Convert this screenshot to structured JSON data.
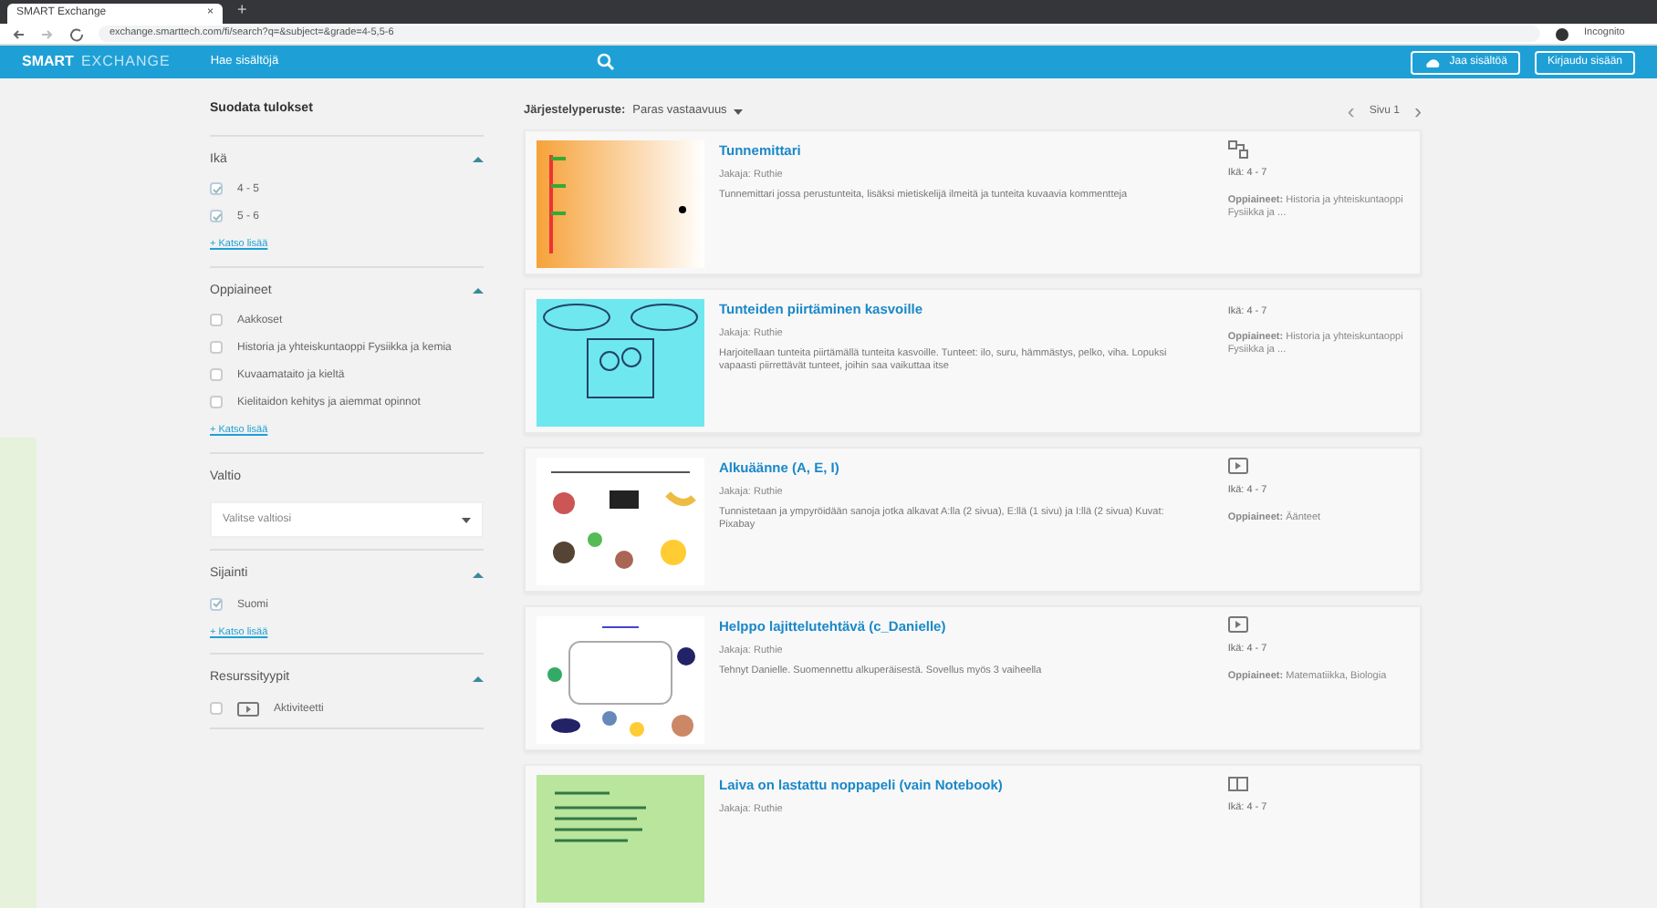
{
  "browser": {
    "tab_title": "SMART Exchange",
    "tab_close": "×",
    "new_tab": "+",
    "address": "exchange.smarttech.com/fi/search?q=&subject=&grade=4-5,5-6",
    "profile": "Incognito"
  },
  "navbar": {
    "logo_primary": "SMART",
    "logo_secondary": "EXCHANGE",
    "search_link": "Hae sisältöjä",
    "upload_button": "Jaa sisältöä",
    "login_button": "Kirjaudu sisään"
  },
  "sidebar": {
    "title": "Suodata tulokset",
    "groups": [
      {
        "kind": "checklist",
        "title": "Ikä",
        "options": [
          {
            "label": "4 - 5",
            "checked": true
          },
          {
            "label": "5 - 6",
            "checked": true
          }
        ],
        "more": "+ Katso lisää"
      },
      {
        "kind": "checklist",
        "title": "Oppiaineet",
        "options": [
          {
            "label": "Aakkoset",
            "checked": false
          },
          {
            "label": "Historia ja yhteiskuntaoppi Fysiikka ja kemia",
            "checked": false
          },
          {
            "label": "Kuvaamataito ja kieltä",
            "checked": false
          },
          {
            "label": "Kielitaidon kehitys ja aiemmat opinnot",
            "checked": false
          }
        ],
        "more": "+ Katso lisää"
      },
      {
        "kind": "select",
        "title": "Valtio",
        "placeholder": "Valitse valtiosi"
      },
      {
        "kind": "checklist",
        "title": "Sijainti",
        "options": [
          {
            "label": "Suomi",
            "checked": true
          }
        ],
        "more": "+ Katso lisää"
      },
      {
        "kind": "typelist",
        "title": "Resurssityypit",
        "options": [
          {
            "label": "Aktiviteetti",
            "checked": false
          }
        ]
      }
    ]
  },
  "results": {
    "sort_label": "Järjestelyperuste:",
    "sort_value": "Paras vastaavuus",
    "pagination": {
      "prev": "‹",
      "page": "Sivu 1",
      "next": "›"
    },
    "items": [
      {
        "kind": "diagram",
        "title": "Tunnemittari",
        "author_label": "Jakaja:",
        "author": "Ruthie",
        "description": "Tunnemittari jossa perustunteita, lisäksi mietiskelijä ilmeitä ja tunteita kuvaavia kommentteja",
        "age": "Ikä: 4 - 7",
        "subjects": "**Oppiaineet:** Historia ja yhteiskuntaoppi Fysiikka ja ..."
      },
      {
        "kind": "plain",
        "title": "Tunteiden piirtäminen kasvoille",
        "author_label": "Jakaja:",
        "author": "Ruthie",
        "description": "Harjoitellaan tunteita piirtämällä tunteita kasvoille. Tunteet: ilo, suru, hämmästys, pelko, viha. Lopuksi vapaasti piirrettävät tunteet, joihin saa vaikuttaa itse",
        "age": "Ikä: 4 - 7",
        "subjects": "**Oppiaineet:** Historia ja yhteiskuntaoppi Fysiikka ja ..."
      },
      {
        "kind": "screen",
        "title": "Alkuäänne (A, E, I)",
        "author_label": "Jakaja:",
        "author": "Ruthie",
        "description": "Tunnistetaan ja ympyröidään sanoja jotka alkavat A:lla (2 sivua), E:llä (1 sivu) ja I:llä (2 sivua) Kuvat: Pixabay",
        "age": "Ikä: 4 - 7",
        "subjects": "**Oppiaineet:** Äänteet"
      },
      {
        "kind": "screen",
        "title": "Helppo lajittelutehtävä (c_Danielle)",
        "author_label": "Jakaja:",
        "author": "Ruthie",
        "description": "Tehnyt Danielle. Suomennettu alkuperäisestä. Sovellus myös 3 vaiheella",
        "age": "Ikä: 4 - 7",
        "subjects": "**Oppiaineet:** Matematiikka, Biologia"
      },
      {
        "kind": "book",
        "title": "Laiva on lastattu noppapeli (vain Notebook)",
        "author_label": "Jakaja:",
        "author": "Ruthie",
        "age": "Ikä: 4 - 7"
      }
    ]
  }
}
